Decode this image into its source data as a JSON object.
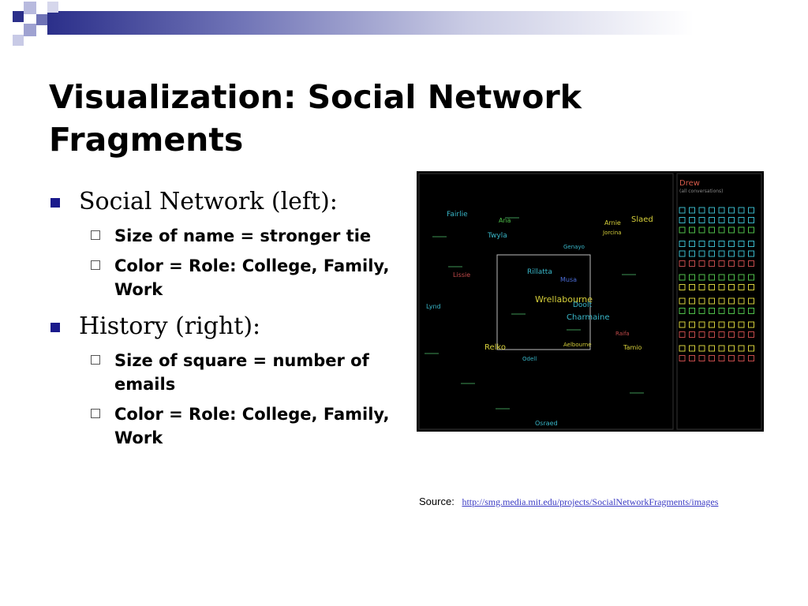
{
  "slide": {
    "title": "Visualization: Social Network Fragments",
    "bullets": [
      {
        "text": "Social Network (left):",
        "children": [
          "Size of name = stronger tie",
          "Color = Role: College, Family, Work"
        ]
      },
      {
        "text": "History (right):",
        "children": [
          "Size of square = number of emails",
          "Color = Role: College, Family, Work"
        ]
      }
    ],
    "source_label": "Source:",
    "source_url": "http://smg.media.mit.edu/projects/SocialNetworkFragments/images"
  },
  "visualization": {
    "history_title": "Drew",
    "history_subtitle": "(all conversations)",
    "names": [
      "Fairlie",
      "Ana",
      "Arnie",
      "Slaed",
      "Jorcina",
      "Twyla",
      "Genayo",
      "Rillatta",
      "Lissie",
      "Musa",
      "Wrellabourne",
      "Doolt",
      "Charmaine",
      "Lynd",
      "Odell",
      "Relko",
      "Tamio",
      "Osraed",
      "Aelbourne",
      "Raifa"
    ],
    "colors": {
      "college": "#39b7c9",
      "family": "#d6cf3a",
      "work": "#4fbf4a",
      "other": "#c24a4a",
      "blue": "#4b6cd6"
    }
  }
}
